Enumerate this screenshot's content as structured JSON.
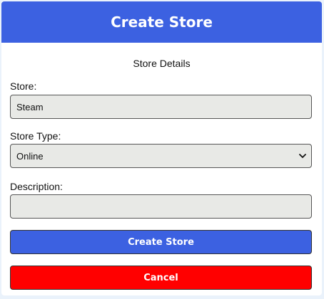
{
  "header": {
    "title": "Create Store"
  },
  "form": {
    "section_title": "Store Details",
    "store": {
      "label": "Store:",
      "value": "Steam"
    },
    "store_type": {
      "label": "Store Type:",
      "selected": "Online",
      "options": [
        "Online"
      ]
    },
    "description": {
      "label": "Description:",
      "value": ""
    }
  },
  "actions": {
    "create_label": "Create Store",
    "cancel_label": "Cancel"
  },
  "colors": {
    "primary": "#3c61e1",
    "danger": "#ff0000",
    "field_bg": "#e8e9e6",
    "page_bg": "#eaf2fb"
  }
}
